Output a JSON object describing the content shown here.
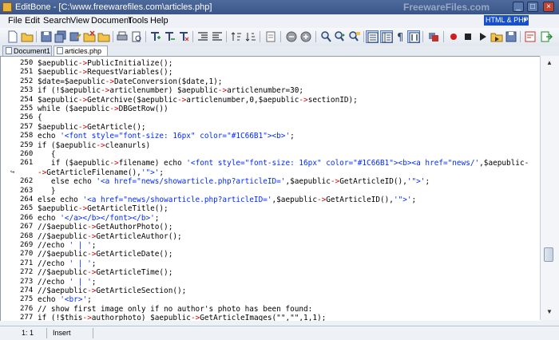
{
  "window": {
    "title": "EditBone - [C:\\www.freewarefiles.com\\articles.php]",
    "watermark": "FreewareFiles.com",
    "minimize": "_",
    "maximize": "□",
    "close": "×"
  },
  "menu": [
    "File",
    "Edit",
    "Search",
    "View",
    "Document",
    "Tools",
    "Help"
  ],
  "language_select": {
    "value": "HTML & PHP"
  },
  "tabs": [
    {
      "label": "Document1",
      "active": false
    },
    {
      "label": "articles.php",
      "active": true
    }
  ],
  "editor": {
    "lines": [
      {
        "n": "250",
        "t": "$aepublic->PublicInitialize();"
      },
      {
        "n": "251",
        "t": "$aepublic->RequestVariables();"
      },
      {
        "n": "252",
        "t": "$date=$aepublic->DateConversion($date,1);"
      },
      {
        "n": "253",
        "t": "if (!$aepublic->articlenumber) $aepublic->articlenumber=30;"
      },
      {
        "n": "254",
        "t": "$aepublic->GetArchive($aepublic->articlenumber,0,$aepublic->sectionID);"
      },
      {
        "n": "255",
        "t": "while ($aepublic->DBGetRow())"
      },
      {
        "n": "256",
        "t": "{"
      },
      {
        "n": "257",
        "t": "$aepublic->GetArticle();"
      },
      {
        "n": "258",
        "t": "echo '<font style=\"font-size: 16px\" color=\"#1C66B1\"><b>';"
      },
      {
        "n": "259",
        "t": "if ($aepublic->cleanurls)"
      },
      {
        "n": "260",
        "t": "   {"
      },
      {
        "n": "261",
        "t": "   if ($aepublic->filename) echo '<font style=\"font-size: 16px\" color=\"#1C66B1\"><b><a href=\"news/',$aepublic-"
      },
      {
        "n": "",
        "t": "->GetArticleFilename(),'\">';"
      },
      {
        "n": "262",
        "t": "   else echo '<a href=\"news/showarticle.php?articleID=',$aepublic->GetArticleID(),'\">';"
      },
      {
        "n": "263",
        "t": "   }"
      },
      {
        "n": "264",
        "t": "else echo '<a href=\"news/showarticle.php?articleID=',$aepublic->GetArticleID(),'\">';"
      },
      {
        "n": "265",
        "t": "$aepublic->GetArticleTitle();"
      },
      {
        "n": "266",
        "t": "echo '</a></b></font></b>';"
      },
      {
        "n": "267",
        "t": "//$aepublic->GetAuthorPhoto();"
      },
      {
        "n": "268",
        "t": "//$aepublic->GetArticleAuthor();"
      },
      {
        "n": "269",
        "t": "//echo ' | ';"
      },
      {
        "n": "270",
        "t": "//$aepublic->GetArticleDate();"
      },
      {
        "n": "271",
        "t": "//echo ' | ';"
      },
      {
        "n": "272",
        "t": "//$aepublic->GetArticleTime();"
      },
      {
        "n": "273",
        "t": "//echo ' | ';"
      },
      {
        "n": "274",
        "t": "//$aepublic->GetArticleSection();"
      },
      {
        "n": "275",
        "t": "echo '<br>';"
      },
      {
        "n": "276",
        "t": "// show first image only if no author's photo has been found:"
      },
      {
        "n": "277",
        "t": "if (!$this->authorphoto) $aepublic->GetArticleImages(\"\",\"\",1,1);"
      }
    ]
  },
  "status": {
    "position": "1: 1",
    "mode": "Insert"
  },
  "colors": {
    "titlebar": "#3a5588",
    "selection": "#1750c8",
    "string": "#002aff",
    "operator": "#d10000"
  }
}
